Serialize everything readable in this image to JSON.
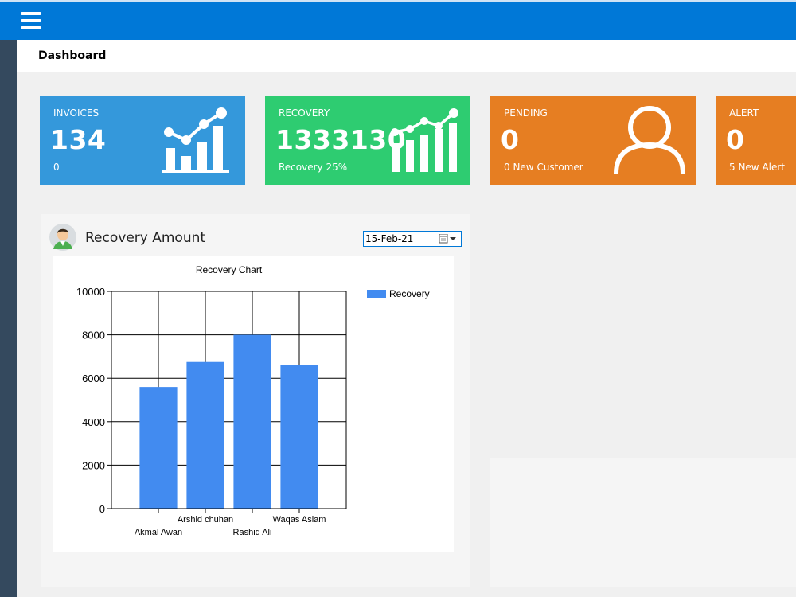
{
  "page": {
    "title": "Dashboard"
  },
  "tiles": [
    {
      "label": "INVOICES",
      "value": "134",
      "sub": "0",
      "color": "#3498db",
      "icon": "bar-chart-icon"
    },
    {
      "label": "RECOVERY",
      "value": "1333130",
      "sub": "Recovery 25%",
      "color": "#2ecc71",
      "icon": "bar-chart-icon"
    },
    {
      "label": "PENDING",
      "value": "0",
      "sub": "0 New Customer",
      "color": "#e67e22",
      "icon": "user-icon"
    },
    {
      "label": "ALERT",
      "value": "0",
      "sub": "5 New Alert",
      "color": "#e67e22",
      "icon": ""
    }
  ],
  "recovery_panel": {
    "title": "Recovery Amount",
    "date_value": "15-Feb-21"
  },
  "chart_data": {
    "type": "bar",
    "title": "Recovery Chart",
    "categories": [
      "Akmal Awan",
      "Arshid chuhan",
      "Rashid Ali",
      "Waqas Aslam"
    ],
    "series": [
      {
        "name": "Recovery",
        "values": [
          5600,
          6750,
          8000,
          6600
        ],
        "color": "#428bf0"
      }
    ],
    "ylim": [
      0,
      10000
    ],
    "yticks": [
      "0",
      "2000",
      "4000",
      "6000",
      "8000",
      "10000"
    ],
    "grid": true,
    "legend": "top-right"
  },
  "colors": {
    "topbar": "#0078d7",
    "sidebar": "#34495e"
  }
}
